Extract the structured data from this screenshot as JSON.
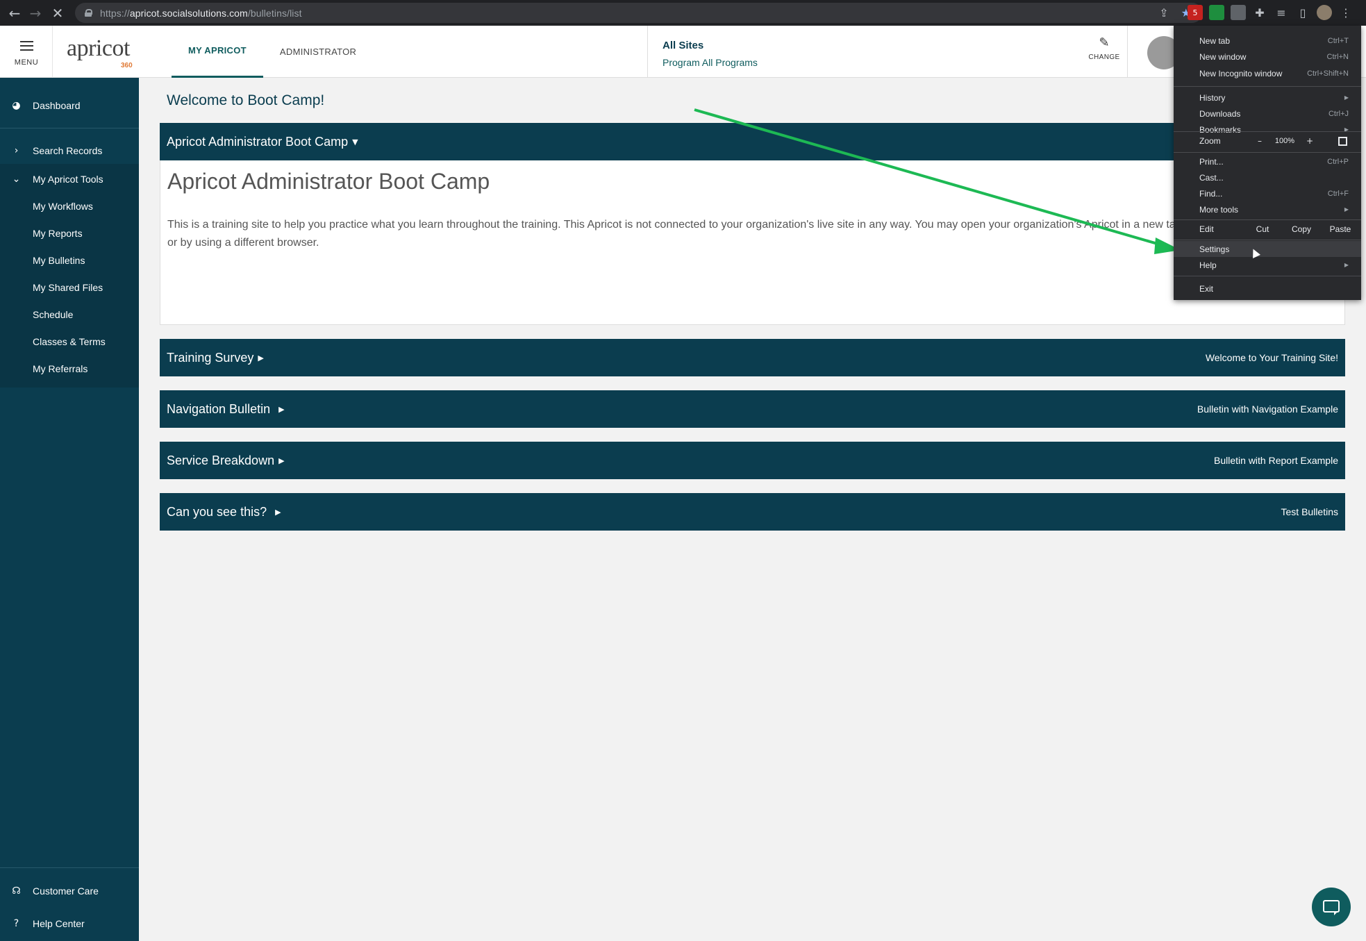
{
  "browser": {
    "url_prefix": "https://",
    "url_host": "apricot.socialsolutions.com",
    "url_path": "/bulletins/list",
    "ext_badge": "5"
  },
  "header": {
    "menu_label": "MENU",
    "logo_text": "apricot",
    "logo_num": "360",
    "tabs": [
      {
        "label": "MY APRICOT",
        "active": true
      },
      {
        "label": "ADMINISTRATOR",
        "active": false
      }
    ],
    "sites_label": "All Sites",
    "program_label": "Program All Programs",
    "change_label": "CHANGE"
  },
  "sidebar": {
    "items": [
      {
        "label": "Dashboard",
        "icon": "dashboard-icon"
      },
      {
        "label": "Search Records",
        "icon": "chevron-right-icon"
      },
      {
        "label": "My Apricot Tools",
        "icon": "chevron-down-icon"
      },
      {
        "label": "My Workflows"
      },
      {
        "label": "My Reports"
      },
      {
        "label": "My Bulletins"
      },
      {
        "label": "My Shared Files"
      },
      {
        "label": "Schedule"
      },
      {
        "label": "Classes & Terms"
      },
      {
        "label": "My Referrals"
      }
    ],
    "bottom": [
      {
        "label": "Customer Care",
        "icon": "headset-icon"
      },
      {
        "label": "Help Center",
        "icon": "help-icon"
      }
    ]
  },
  "main": {
    "welcome": "Welcome to Boot Camp!",
    "bulletins": [
      {
        "title": "Apricot Administrator Boot Camp",
        "right": "",
        "expanded": true
      },
      {
        "title": "Training Survey",
        "right": "Welcome to Your Training Site!"
      },
      {
        "title": "Navigation Bulletin",
        "right": "Bulletin with Navigation Example"
      },
      {
        "title": "Service Breakdown",
        "right": "Bulletin with Report Example"
      },
      {
        "title": "Can you see this?",
        "right": "Test Bulletins"
      }
    ],
    "expanded_heading": "Apricot Administrator Boot Camp",
    "expanded_text": "This is a training site to help you practice what you learn throughout the training. This Apricot is not connected to your organization's live site in any way. You may open your organization's Apricot in a new tab, a new private browsing window, or by using a different browser."
  },
  "chrome_menu": {
    "new_tab": {
      "label": "New tab",
      "shortcut": "Ctrl+T"
    },
    "new_window": {
      "label": "New window",
      "shortcut": "Ctrl+N"
    },
    "new_incognito": {
      "label": "New Incognito window",
      "shortcut": "Ctrl+Shift+N"
    },
    "history": {
      "label": "History"
    },
    "downloads": {
      "label": "Downloads",
      "shortcut": "Ctrl+J"
    },
    "bookmarks": {
      "label": "Bookmarks"
    },
    "zoom": {
      "label": "Zoom",
      "minus": "–",
      "value": "100%",
      "plus": "+"
    },
    "print": {
      "label": "Print...",
      "shortcut": "Ctrl+P"
    },
    "cast": {
      "label": "Cast..."
    },
    "find": {
      "label": "Find...",
      "shortcut": "Ctrl+F"
    },
    "more_tools": {
      "label": "More tools"
    },
    "edit": {
      "label": "Edit",
      "cut": "Cut",
      "copy": "Copy",
      "paste": "Paste"
    },
    "settings": {
      "label": "Settings"
    },
    "help": {
      "label": "Help"
    },
    "exit": {
      "label": "Exit"
    }
  },
  "colors": {
    "brand_dark": "#0b3d4f",
    "brand_teal": "#0f5c5e",
    "logo_orange": "#e07a36",
    "annotation_arrow": "#1db954"
  }
}
